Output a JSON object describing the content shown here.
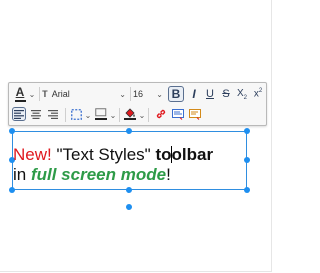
{
  "toolbar": {
    "text_color_icon": "A",
    "font_name": "Arial",
    "font_size": "16",
    "bold_label": "B",
    "italic_label": "I",
    "underline_label": "U",
    "strike_label": "S",
    "subscript_label": "X",
    "subscript_sub": "2",
    "superscript_label": "x",
    "superscript_sup": "2",
    "colors": {
      "text_color_underline": "#e0191f",
      "link_icon": "#e0191f",
      "highlight_fill": "#e0191f"
    }
  },
  "content": {
    "line1_part1": "New!",
    "line1_part2": " \"Text Styles\" ",
    "line1_part3a": "to",
    "line1_part3b": "olbar",
    "line2_part1": "in ",
    "line2_part2": "full screen mode",
    "line2_part3": "!"
  }
}
